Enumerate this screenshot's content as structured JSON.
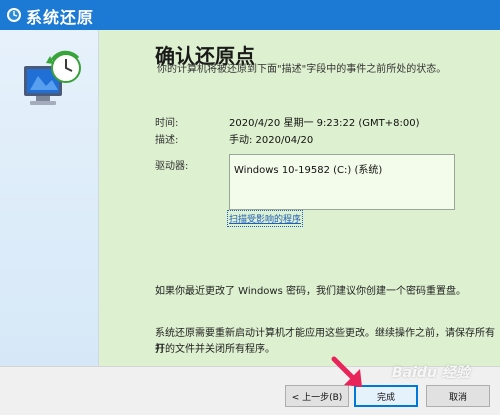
{
  "window": {
    "title": "系统还原",
    "icon": "system-restore-icon"
  },
  "main": {
    "heading": "确认还原点",
    "intro": "你的计算机将被还原到下面\"描述\"字段中的事件之前所处的状态。",
    "time_label": "时间:",
    "time_value": "2020/4/20 星期一 9:23:22 (GMT+8:00)",
    "desc_label": "描述:",
    "desc_value": "手动: 2020/04/20",
    "drives_label": "驱动器:",
    "drives_value": "Windows 10-19582 (C:) (系统)",
    "scan_link": "扫描受影响的程序",
    "password_note": "如果你最近更改了 Windows 密码，我们建议你创建一个密码重置盘。",
    "restart_note_line1": "系统还原需要重新启动计算机才能应用这些更改。继续操作之前，请保存所有打",
    "restart_note_line2": "开的文件并关闭所有程序。"
  },
  "buttons": {
    "back": "< 上一步(B)",
    "finish": "完成",
    "cancel": "取消"
  },
  "watermark": "Baidu 经验",
  "colors": {
    "titlebar": "#1c79d4",
    "main_bg": "#ddf0cf",
    "link": "#1f5fbf",
    "arrow": "#e8245a"
  }
}
